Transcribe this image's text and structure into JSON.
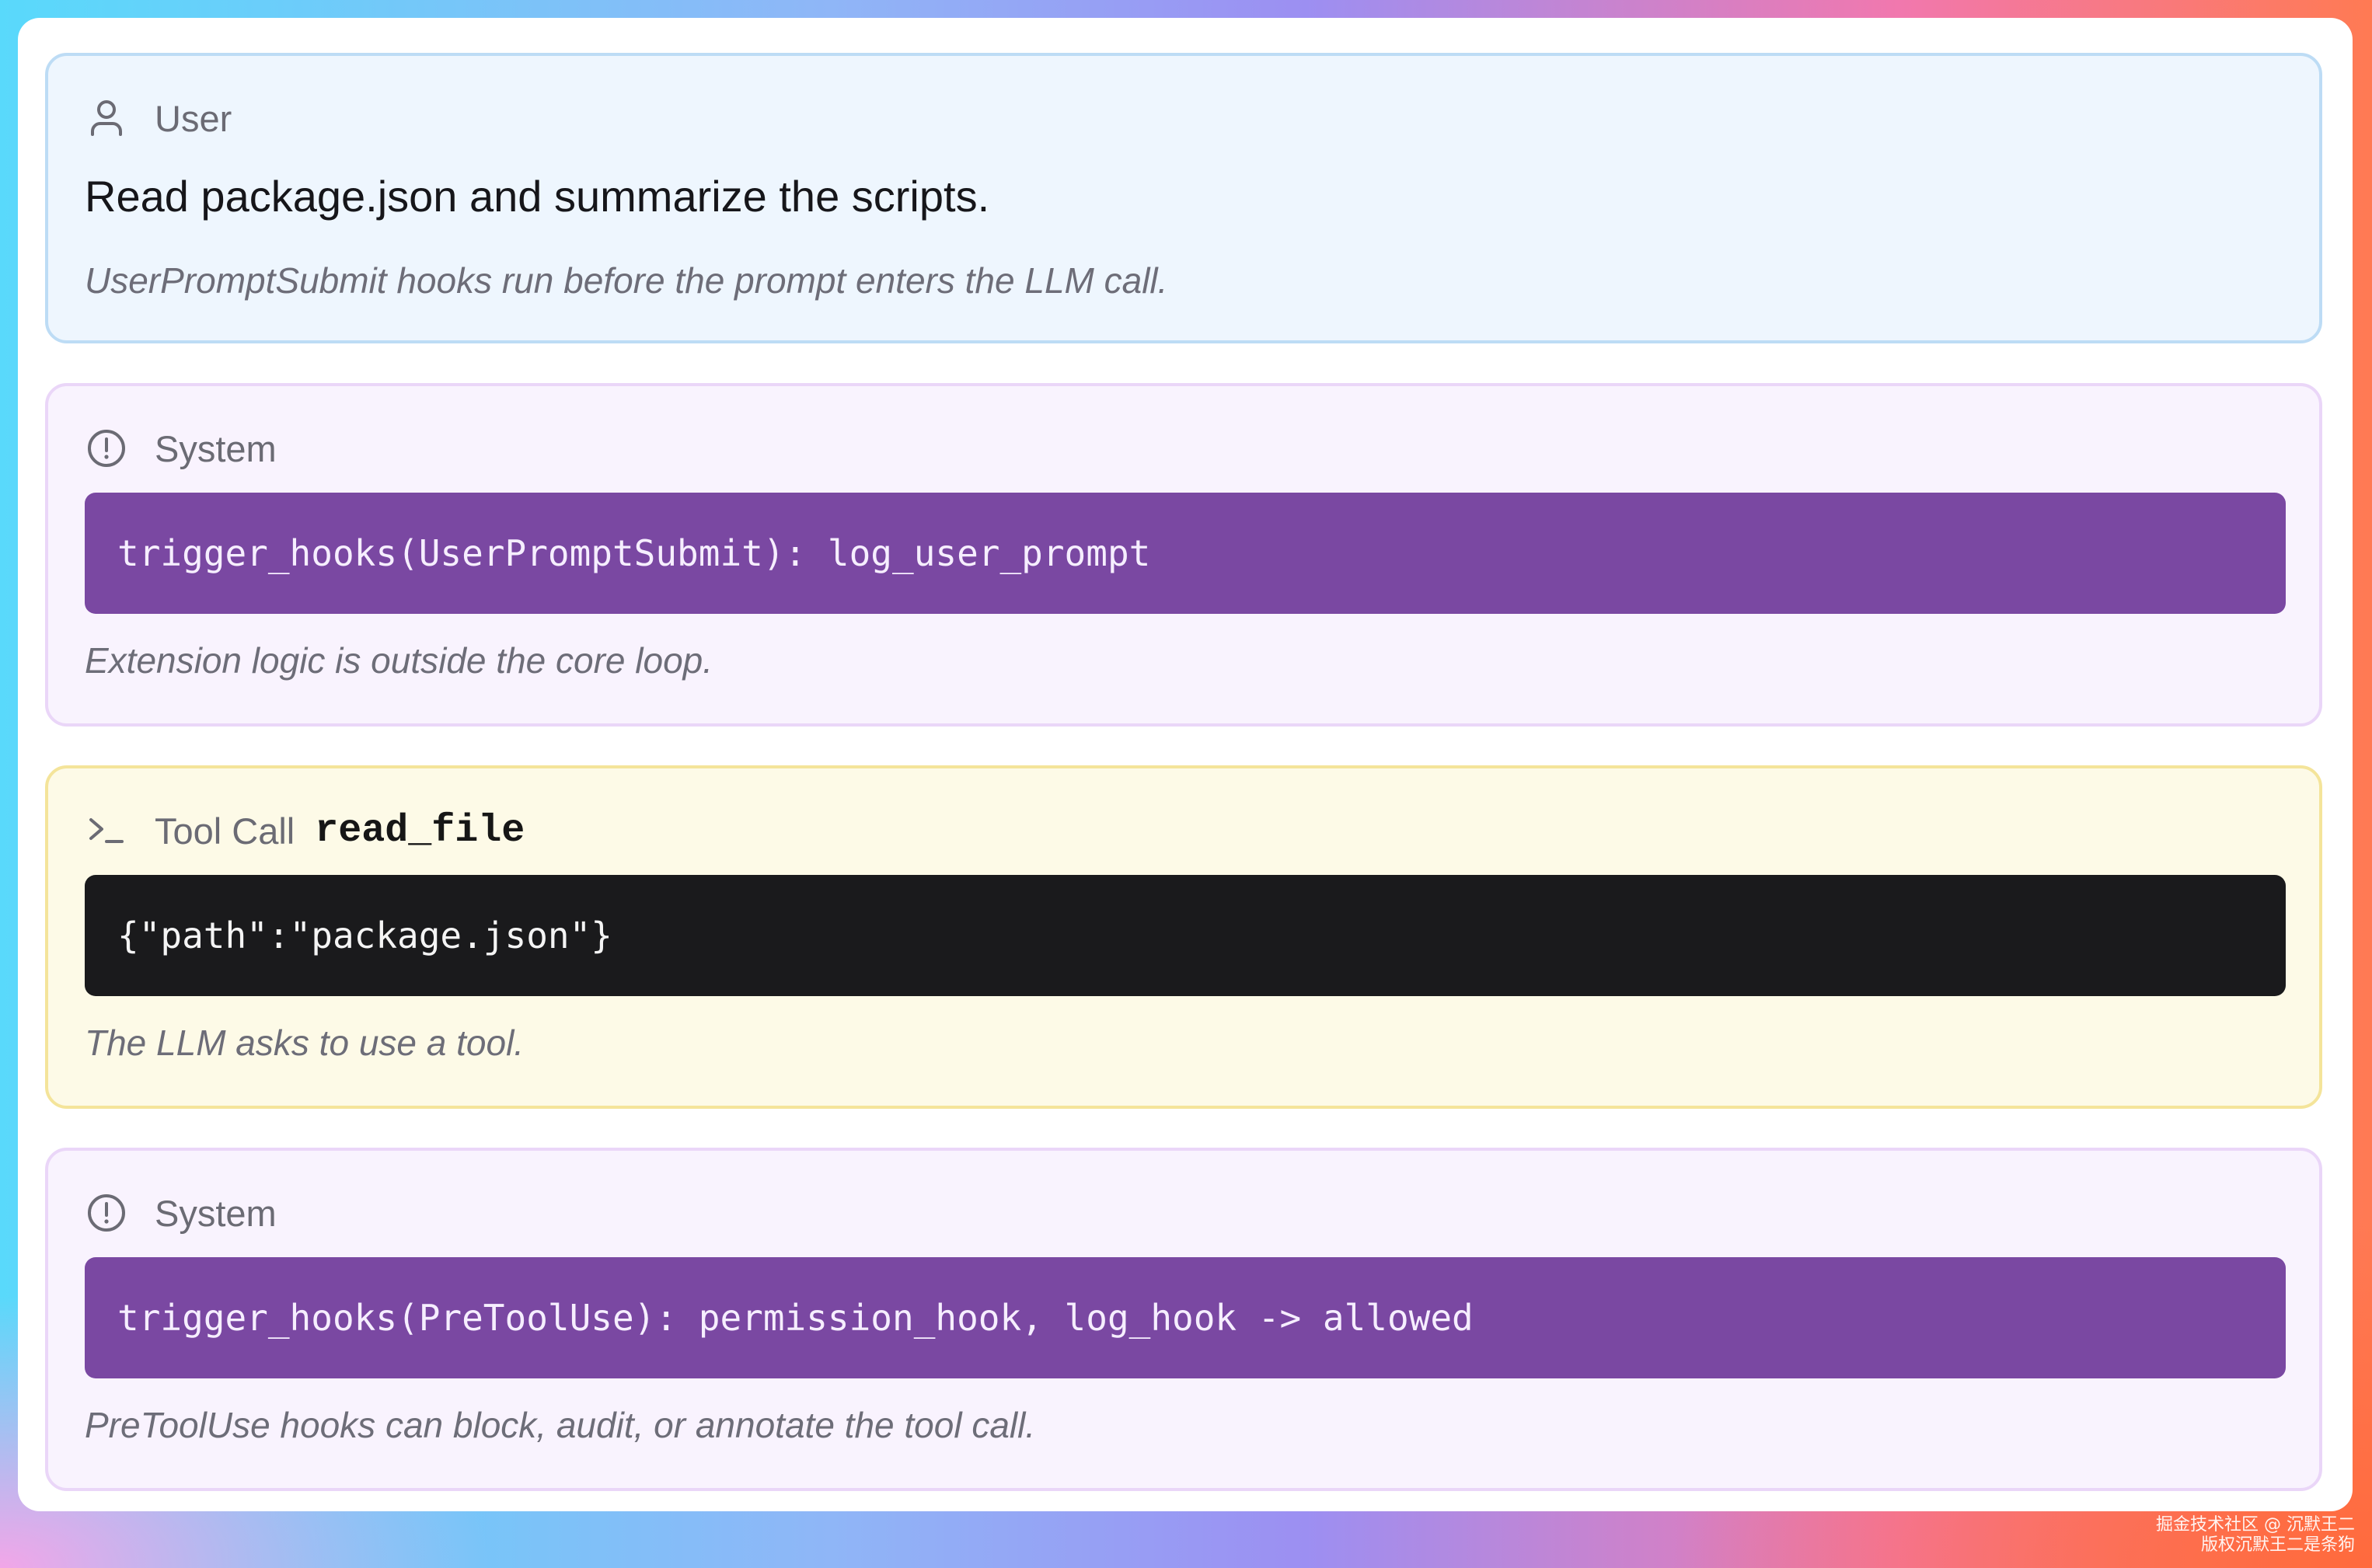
{
  "messages": [
    {
      "role_label": "User",
      "icon": "user-icon",
      "text": "Read package.json and summarize the scripts.",
      "note": "UserPromptSubmit hooks run before the prompt enters the LLM call."
    },
    {
      "role_label": "System",
      "icon": "alert-circle-icon",
      "code": "trigger_hooks(UserPromptSubmit): log_user_prompt",
      "note": "Extension logic is outside the core loop."
    },
    {
      "role_label": "Tool Call",
      "tool_name": "read_file",
      "icon": "terminal-prompt-icon",
      "code": "{\"path\":\"package.json\"}",
      "note": "The LLM asks to use a tool."
    },
    {
      "role_label": "System",
      "icon": "alert-circle-icon",
      "code": "trigger_hooks(PreToolUse): permission_hook, log_hook -> allowed",
      "note": "PreToolUse hooks can block, audit, or annotate the tool call."
    }
  ],
  "watermark": {
    "line1": "掘金技术社区 @ 沉默王二",
    "line2": "版权沉默王二是条狗"
  },
  "colors": {
    "user_card_bg": "#eef6fe",
    "system_card_bg": "#f9f3fe",
    "tool_card_bg": "#fdfae7",
    "system_code_bg": "#7a48a2",
    "tool_code_bg": "#1a1a1c"
  }
}
